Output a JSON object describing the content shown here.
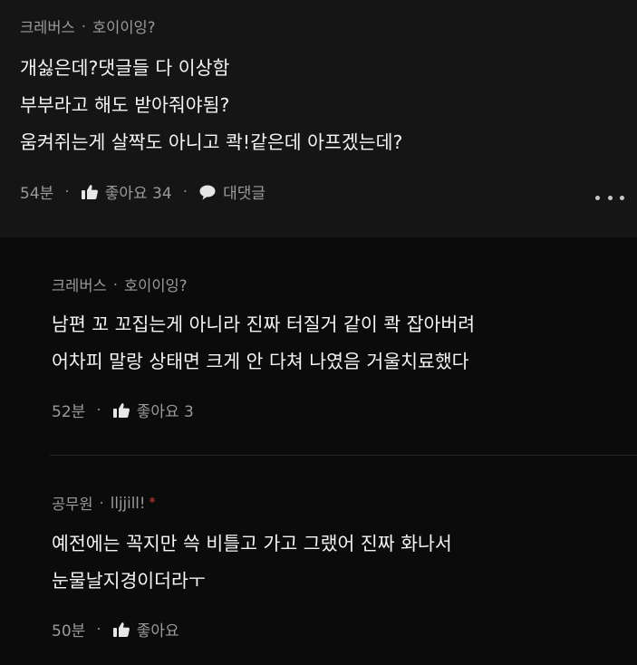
{
  "comment": {
    "author": "크레버스",
    "nickname": "호이이잉?",
    "lines": [
      "개싫은데?댓글들 다 이상함",
      "부부라고 해도 받아줘야됨?",
      "움켜쥐는게 살짝도 아니고 콱!같은데 아프겠는데?"
    ],
    "time": "54분",
    "like_label": "좋아요 34",
    "reply_label": "대댓글",
    "separator": "·"
  },
  "replies": [
    {
      "author": "크레버스",
      "nickname": "호이이잉?",
      "lines": [
        "남편 꼬 꼬집는게 아니라 진짜 터질거 같이 콱 잡아버려",
        "어차피 말랑 상태면 크게 안 다쳐 나였음 거울치료했다"
      ],
      "time": "52분",
      "like_label": "좋아요 3"
    },
    {
      "author": "공무원",
      "nickname": "lljjill!",
      "star": "*",
      "lines": [
        "예전에는 꼭지만 쓱 비틀고 가고 그랬어 진짜 화나서",
        "눈물날지경이더라ㅜ"
      ],
      "time": "50분",
      "like_label": "좋아요"
    }
  ],
  "colors": {
    "background": "#000000",
    "comment_bg": "#151515",
    "reply_bg": "#0b0b0b",
    "meta_text": "#9a9a9a",
    "body_text": "#f4f4f4",
    "star": "#e0443e"
  },
  "icons": {
    "like": "thumbs-up-icon",
    "reply": "speech-bubble-icon",
    "more": "more-dots-icon"
  }
}
